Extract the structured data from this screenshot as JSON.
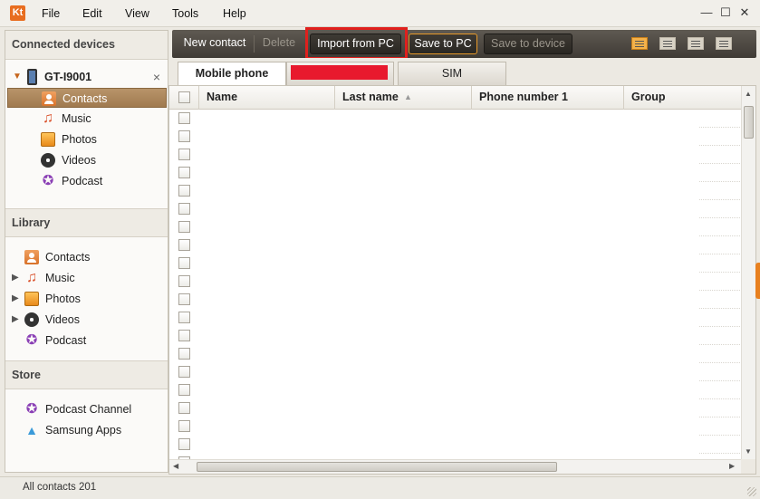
{
  "app": {
    "logo_text": "Kt"
  },
  "menu": {
    "items": [
      {
        "label": "File"
      },
      {
        "label": "Edit"
      },
      {
        "label": "View"
      },
      {
        "label": "Tools"
      },
      {
        "label": "Help"
      }
    ]
  },
  "window_controls": {
    "minimize": "—",
    "maximize": "☐",
    "close": "✕"
  },
  "sidebar": {
    "connected_title": "Connected devices",
    "device": {
      "name": "GT-I9001",
      "remove": "×"
    },
    "device_items": [
      {
        "label": "Contacts",
        "icon": "contacts-icon",
        "selected": true
      },
      {
        "label": "Music",
        "icon": "music-icon"
      },
      {
        "label": "Photos",
        "icon": "photos-icon"
      },
      {
        "label": "Videos",
        "icon": "videos-icon"
      },
      {
        "label": "Podcast",
        "icon": "podcast-icon"
      }
    ],
    "library_title": "Library",
    "library_items": [
      {
        "label": "Contacts",
        "icon": "contacts-icon"
      },
      {
        "label": "Music",
        "icon": "music-icon",
        "expandable": true
      },
      {
        "label": "Photos",
        "icon": "photos-icon",
        "expandable": true
      },
      {
        "label": "Videos",
        "icon": "videos-icon",
        "expandable": true
      },
      {
        "label": "Podcast",
        "icon": "podcast-icon"
      }
    ],
    "store_title": "Store",
    "store_items": [
      {
        "label": "Podcast Channel",
        "icon": "podcast-icon"
      },
      {
        "label": "Samsung Apps",
        "icon": "samsung-apps-icon"
      }
    ]
  },
  "toolbar": {
    "new_contact": "New contact",
    "delete": "Delete",
    "import_from_pc": "Import from PC",
    "save_to_pc": "Save to PC",
    "save_to_device": "Save to device"
  },
  "tabs": {
    "mobile_phone": "Mobile phone",
    "sim": "SIM"
  },
  "grid": {
    "columns": [
      "Name",
      "Last name",
      "Phone number 1",
      "Group"
    ],
    "visible_rows": 20
  },
  "status": {
    "text": "All contacts 201"
  },
  "colors": {
    "accent_orange": "#e8801f",
    "highlight_red": "#e0201d",
    "redaction_red": "#e8192d",
    "selected_row": "#a07a4f"
  }
}
